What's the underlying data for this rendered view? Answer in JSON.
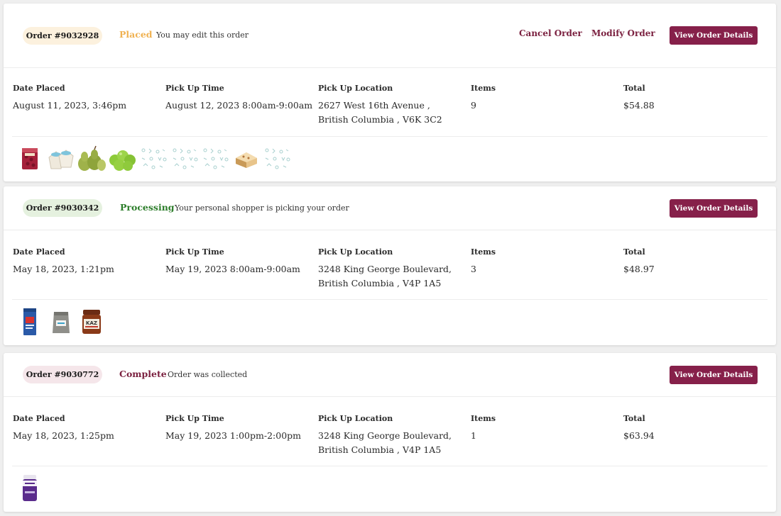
{
  "labels": {
    "date_placed": "Date Placed",
    "pickup_time": "Pick Up Time",
    "pickup_location": "Pick Up Location",
    "items": "Items",
    "total": "Total"
  },
  "orders": [
    {
      "order_label": "Order #9032928",
      "status": "Placed",
      "status_message": "You may edit this order",
      "cancel_label": "Cancel Order",
      "modify_label": "Modify Order",
      "view_label": "View Order Details",
      "date_placed": "August 11, 2023, 3:46pm",
      "pickup_time": "August 12, 2023 8:00am-9:00am",
      "location_line1": "2627 West 16th Avenue ,",
      "location_line2": "British Columbia , V6K 3C2",
      "items": "9",
      "total": "$54.88",
      "thumbnails": [
        "cranberries-bag",
        "coconuts",
        "pears",
        "green-apples",
        "placeholder",
        "placeholder",
        "placeholder",
        "pastry",
        "placeholder"
      ]
    },
    {
      "order_label": "Order #9030342",
      "status": "Processing",
      "status_message": "Your personal shopper is picking your order",
      "view_label": "View Order Details",
      "date_placed": "May 18, 2023, 1:21pm",
      "pickup_time": "May 19, 2023 8:00am-9:00am",
      "location_line1": "3248 King George Boulevard,",
      "location_line2": "British Columbia , V4P 1A5",
      "items": "3",
      "total": "$48.97",
      "thumbnails": [
        "coffee-bag-blue",
        "coffee-bag-gray",
        "jar"
      ]
    },
    {
      "order_label": "Order #9030772",
      "status": "Complete",
      "status_message": "Order was collected",
      "view_label": "View Order Details",
      "date_placed": "May 18, 2023, 1:25pm",
      "pickup_time": "May 19, 2023 1:00pm-2:00pm",
      "location_line1": "3248 King George Boulevard,",
      "location_line2": "British Columbia , V4P 1A5",
      "items": "1",
      "total": "$63.94",
      "thumbnails": [
        "supplement-tub"
      ]
    }
  ],
  "colors": {
    "accent": "#86204a",
    "status_placed": "#f0b252",
    "status_processing": "#2c7d2a",
    "status_complete": "#7b2140"
  }
}
